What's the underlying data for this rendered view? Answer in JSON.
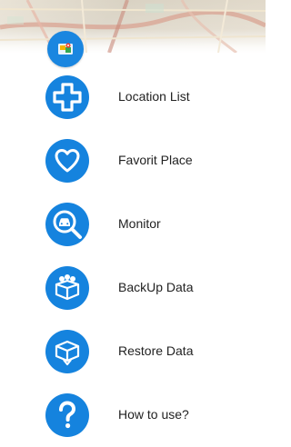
{
  "colors": {
    "accent": "#1583de",
    "text": "#222222",
    "background": "#ffffff"
  },
  "header": {
    "logo_icon": "location-app-logo-icon"
  },
  "menu": {
    "items": [
      {
        "label": "Location List",
        "icon": "plus-cross-icon"
      },
      {
        "label": "Favorit Place",
        "icon": "heart-icon"
      },
      {
        "label": "Monitor",
        "icon": "car-search-icon"
      },
      {
        "label": "BackUp Data",
        "icon": "backup-box-icon"
      },
      {
        "label": "Restore Data",
        "icon": "restore-box-icon"
      },
      {
        "label": "How to use?",
        "icon": "question-mark-icon"
      }
    ]
  }
}
